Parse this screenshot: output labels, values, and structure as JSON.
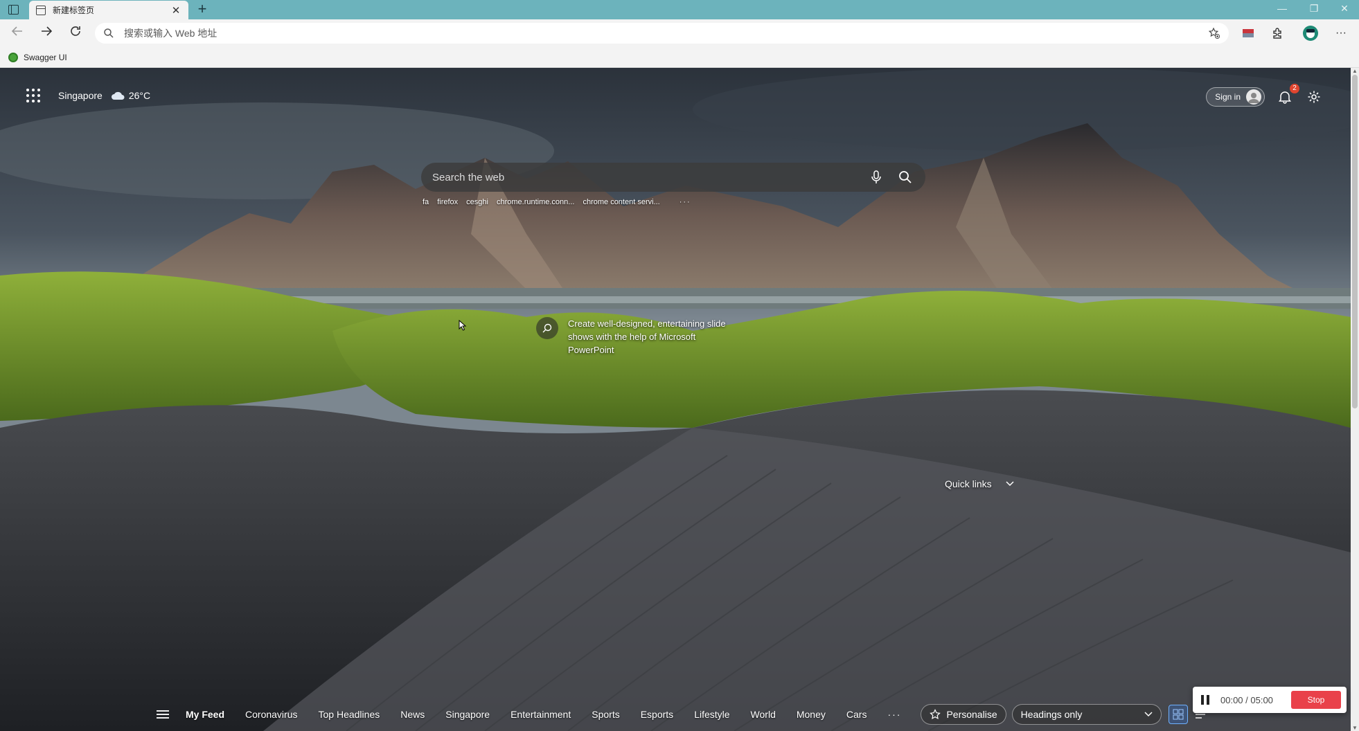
{
  "browser": {
    "tab_title": "新建标签页",
    "tab_close": "✕",
    "new_tab": "+",
    "address_placeholder": "搜索或输入 Web 地址",
    "bookmark_label": "Swagger UI",
    "window_controls": [
      "—",
      "❐",
      "✕"
    ],
    "more_label": "···",
    "colors": {
      "titlebar": "#6cb3bc",
      "toolbar": "#f3f3f3"
    }
  },
  "ntp": {
    "location": "Singapore",
    "temperature": "26°C",
    "sign_in": "Sign in",
    "notification_count": "2",
    "search_placeholder": "Search the web",
    "recent_searches": [
      "fa",
      "firefox",
      "cesghi",
      "chrome.runtime.conn...",
      "chrome content servi..."
    ],
    "recent_more": "···",
    "image_credit": "Create well-designed, entertaining slide shows with the help of Microsoft PowerPoint",
    "quick_links": "Quick links",
    "feed_tabs": [
      "My Feed",
      "Coronavirus",
      "Top Headlines",
      "News",
      "Singapore",
      "Entertainment",
      "Sports",
      "Esports",
      "Lifestyle",
      "World",
      "Money",
      "Cars"
    ],
    "feed_more": "···",
    "personalise": "Personalise",
    "layout_option": "Headings only"
  },
  "recorder": {
    "time": "00:00 / 05:00",
    "stop": "Stop"
  }
}
